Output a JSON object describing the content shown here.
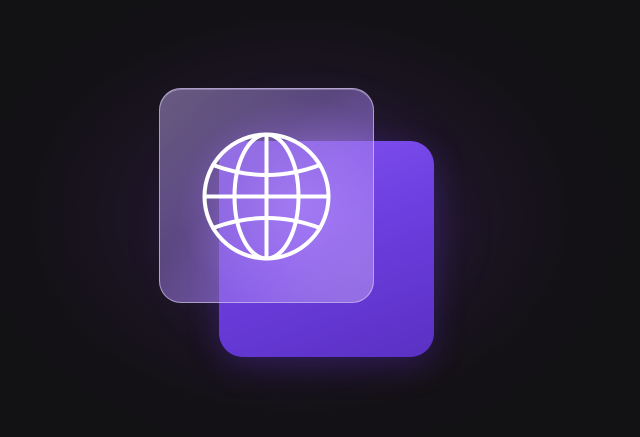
{
  "scene": {
    "icon": "globe-icon",
    "colors": {
      "background": "#141116",
      "back_tile": "#7446e8",
      "front_tile_glass": "#a38ad6",
      "icon_stroke": "#ffffff"
    }
  }
}
